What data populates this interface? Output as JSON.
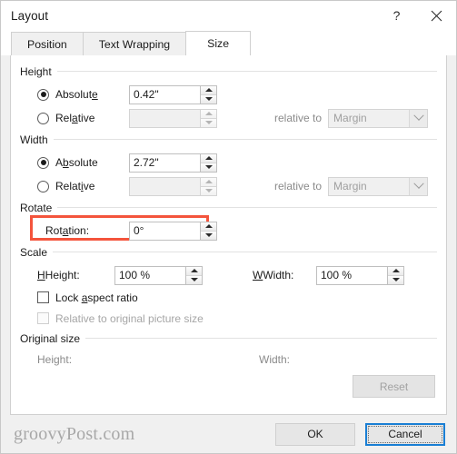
{
  "window": {
    "title": "Layout",
    "help_icon": "question-mark-icon",
    "close_icon": "close-icon"
  },
  "tabs": [
    {
      "label": "Position",
      "active": false
    },
    {
      "label": "Text Wrapping",
      "active": false
    },
    {
      "label": "Size",
      "active": true
    }
  ],
  "groups": {
    "height": {
      "title": "Height",
      "absolute_label": "Absolute",
      "absolute_value": "0.42\"",
      "relative_label": "Relative",
      "relative_value": "",
      "relative_to_label": "relative to",
      "relative_to_value": "Margin"
    },
    "width": {
      "title": "Width",
      "absolute_label": "Absolute",
      "absolute_value": "2.72\"",
      "relative_label": "Relative",
      "relative_value": "",
      "relative_to_label": "relative to",
      "relative_to_value": "Margin"
    },
    "rotate": {
      "title": "Rotate",
      "rotation_label": "Rotation:",
      "rotation_value": "0°",
      "highlight_color": "#f4543c"
    },
    "scale": {
      "title": "Scale",
      "height_label": "Height:",
      "height_value": "100 %",
      "width_label": "Width:",
      "width_value": "100 %",
      "lock_aspect_label": "Lock aspect ratio",
      "relative_original_label": "Relative to original picture size"
    },
    "original_size": {
      "title": "Original size",
      "height_label": "Height:",
      "height_value": "",
      "width_label": "Width:",
      "width_value": "",
      "reset_label": "Reset"
    }
  },
  "footer": {
    "watermark": "groovyPost.com",
    "ok_label": "OK",
    "cancel_label": "Cancel",
    "focus_color": "#1a7fd4"
  }
}
